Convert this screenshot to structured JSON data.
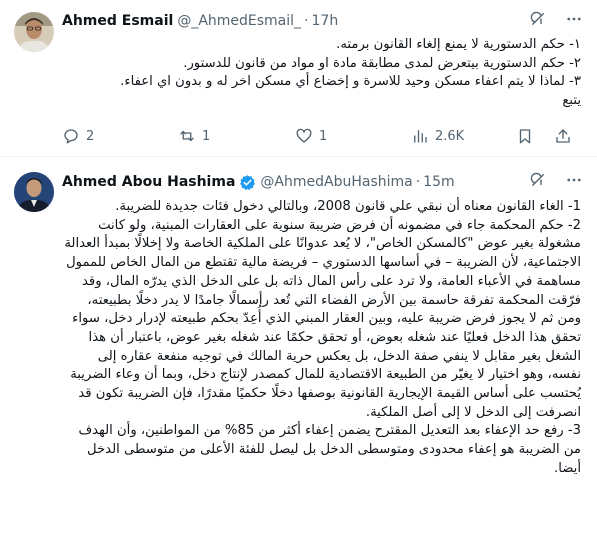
{
  "tweets": [
    {
      "author_name": "Ahmed Esmail",
      "handle": "@_AhmedEsmail_",
      "time": "17h",
      "verified": false,
      "lines": [
        "١- حكم الدستورية لا يمنع إلغاء القانون برمته.",
        "٢- حكم الدستورية بيتعرض لمدى مطابقة مادة او مواد من قانون للدستور.",
        "٣- لماذا لا يتم اعفاء مسكن وحيد للاسرة و إخضاع أي مسكن اخر له و بدون اي اعفاء.",
        "يتبع"
      ],
      "replies": "2",
      "reposts": "1",
      "likes": "1",
      "views": "2.6K"
    },
    {
      "author_name": "Ahmed Abou Hashima",
      "handle": "@AhmedAbuHashima",
      "time": "15m",
      "verified": true,
      "lines": [
        "1- الغاء القانون معناه أن نبقي علي قانون 2008، وبالتالي دخول فئات جديدة للضريبة.",
        "2- حكم المحكمة جاء في مضمونه أن فرض ضريبة سنوية على العقارات المبنية، ولو كانت مشغولة بغير عوض \"كالمسكن الخاص\"، لا يُعد عدوانًا على الملكية الخاصة ولا إخلالًا بمبدأ العدالة الاجتماعية، لأن الضريبة – في أساسها الدستوري – فريضة مالية تقتطع من المال الخاص للممول مساهمة في الأعباء العامة، ولا ترد على رأس المال ذاته بل على الدخل الذي يدرّه المال، وقد فرّقت المحكمة تفرقة حاسمة بين الأرض الفضاء التي تُعد رأسمالًا جامدًا لا يدر دخلًا بطبيعته، ومن ثم لا يجوز فرض ضريبة عليه، وبين العقار المبني الذي أُعِدّ بحكم طبيعته لإدرار دخل، سواء تحقق هذا الدخل فعليًا عند شغله بعوض، أو تحقق حكمًا عند شغله بغير عوض، باعتبار أن هذا الشغل بغير مقابل لا ينفي صفة الدخل، بل يعكس حرية المالك في توجيه منفعة عقاره إلى نفسه، وهو اختيار لا يغيّر من الطبيعة الاقتصادية للمال كمصدر لإنتاج دخل، وبما أن وعاء الضريبة يُحتسب على أساس القيمة الإيجارية القانونية بوصفها دخلًا حكميًا مقدرًا، فإن الضريبة تكون قد انصرفت إلى الدخل لا إلى أصل الملكية.",
        "3- رفع حد الإعفاء بعد التعديل المقترح يضمن إعفاء أكثر من 85% من المواطنين، وأن الهدف من الضريبة هو إعفاء محدودى ومتوسطى الدخل بل ليصل للفئة الأعلى من متوسطى الدخل أيضا."
      ]
    }
  ],
  "icons": {
    "more": "grok-icon",
    "menu": "more-options-icon",
    "reply": "reply-icon",
    "repost": "repost-icon",
    "like": "heart-icon",
    "views": "views-icon",
    "bookmark": "bookmark-icon",
    "share": "share-icon"
  },
  "colors": {
    "verified": "#1d9bf0",
    "secondary_text": "#536471",
    "text": "#0f1419"
  }
}
